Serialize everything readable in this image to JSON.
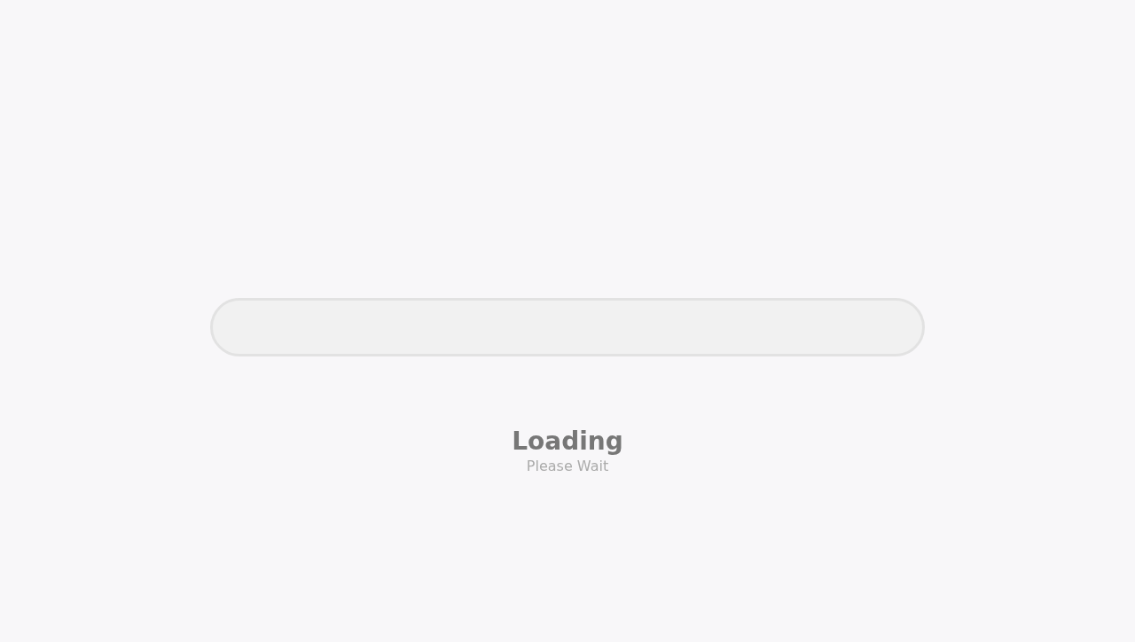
{
  "progress": {
    "level": 0
  },
  "title": "Loading",
  "subtitle": "Please Wait"
}
